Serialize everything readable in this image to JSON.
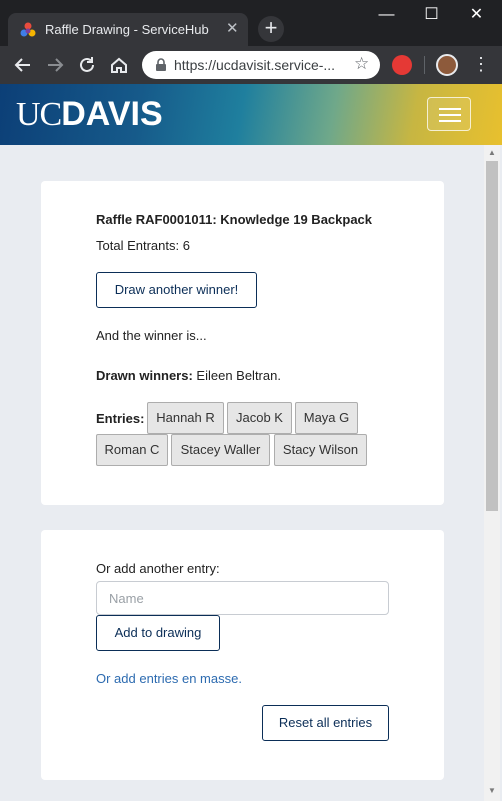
{
  "browser": {
    "tab_title": "Raffle Drawing - ServiceHub",
    "tab_close": "✕",
    "new_tab": "+",
    "url": "https://ucdavisit.service-...",
    "window_controls": {
      "minimize": "—",
      "maximize": "☐",
      "close": "✕"
    }
  },
  "header": {
    "logo_uc": "UC",
    "logo_davis": "DAVIS"
  },
  "raffle": {
    "title": "Raffle RAF0001011: Knowledge 19 Backpack",
    "total_entrants": "Total Entrants: 6",
    "draw_button": "Draw another winner!",
    "winner_text": "And the winner is...",
    "drawn_label": "Drawn winners:",
    "drawn_value": " Eileen Beltran.",
    "entries_label": "Entries:",
    "entries": [
      "Hannah R",
      "Jacob K",
      "Maya G",
      "Roman C",
      "Stacey Waller",
      "Stacy Wilson"
    ]
  },
  "add_entry": {
    "label": "Or add another entry:",
    "input_placeholder": "Name",
    "add_button": "Add to drawing",
    "masse_link": "Or add entries en masse.",
    "reset_button": "Reset all entries"
  }
}
